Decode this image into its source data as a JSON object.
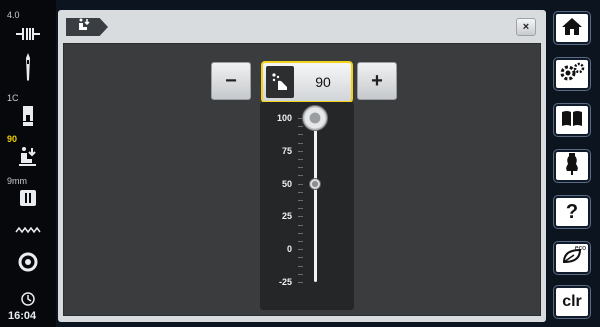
{
  "status": {
    "stitch_width": "4.0",
    "presser_foot": "1C",
    "presser_foot_pressure": "90",
    "stitch_length": "9mm",
    "time": "16:04"
  },
  "dialog": {
    "close_label": "×",
    "decrease_label": "−",
    "increase_label": "+",
    "current_value": "90",
    "scale": {
      "max": 100,
      "min": -25,
      "ticks": [
        "100",
        "75",
        "50",
        "25",
        "0",
        "-25"
      ],
      "knob_value": 100,
      "default_value": 50
    }
  },
  "sidebar_right": {
    "items": [
      {
        "icon": "home-icon"
      },
      {
        "icon": "settings-icon"
      },
      {
        "icon": "book-icon"
      },
      {
        "icon": "dress-form-icon"
      },
      {
        "icon": "help-icon",
        "label": "?"
      },
      {
        "icon": "eco-icon",
        "label": "eco"
      },
      {
        "icon": "clear-icon",
        "label": "clr"
      }
    ]
  },
  "colors": {
    "accent_yellow": "#f2d21a",
    "background": "#0c1420",
    "panel_dark": "#3b3c3e"
  }
}
